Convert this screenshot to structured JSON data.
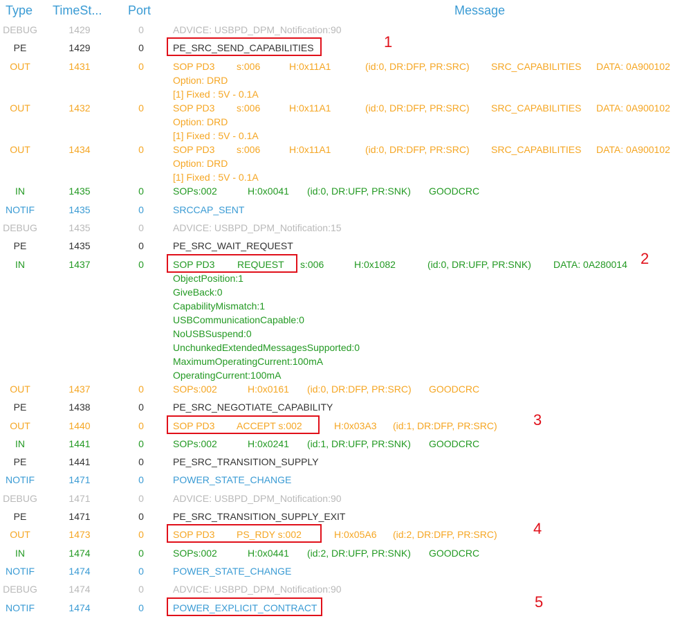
{
  "header": {
    "type": "Type",
    "timestamp": "TimeSt...",
    "port": "Port",
    "message": "Message"
  },
  "colors": {
    "debug": "#b9b9b9",
    "pe": "#333333",
    "out": "#f5a623",
    "in": "#229922",
    "notif": "#3a9bd4",
    "highlight": "#e0101a",
    "header": "#3a9bd4"
  },
  "rows": [
    {
      "type": "DEBUG",
      "ts": "1429",
      "port": "0",
      "segments": [
        "ADVICE: USBPD_DPM_Notification:90"
      ]
    },
    {
      "type": "PE",
      "ts": "1429",
      "port": "0",
      "segments": [
        "PE_SRC_SEND_CAPABILITIES"
      ],
      "callout": "1"
    },
    {
      "type": "OUT",
      "ts": "1431",
      "port": "0",
      "segments": [
        "SOP PD3",
        "s:006",
        "H:0x11A1",
        "(id:0, DR:DFP, PR:SRC)",
        "SRC_CAPABILITIES",
        "DATA: 0A900102"
      ],
      "details": [
        "Option:  DRD",
        " [1] Fixed : 5V - 0.1A"
      ]
    },
    {
      "type": "OUT",
      "ts": "1432",
      "port": "0",
      "segments": [
        "SOP PD3",
        "s:006",
        "H:0x11A1",
        "(id:0, DR:DFP, PR:SRC)",
        "SRC_CAPABILITIES",
        "DATA: 0A900102"
      ],
      "details": [
        "Option:  DRD",
        " [1] Fixed : 5V - 0.1A"
      ]
    },
    {
      "type": "OUT",
      "ts": "1434",
      "port": "0",
      "segments": [
        "SOP PD3",
        "s:006",
        "H:0x11A1",
        "(id:0, DR:DFP, PR:SRC)",
        "SRC_CAPABILITIES",
        "DATA: 0A900102"
      ],
      "details": [
        "Option:  DRD",
        "[1] Fixed : 5V - 0.1A"
      ]
    },
    {
      "type": "IN",
      "ts": "1435",
      "port": "0",
      "segments": [
        "SOPs:002",
        "H:0x0041",
        "(id:0, DR:UFP, PR:SNK)",
        "GOODCRC"
      ]
    },
    {
      "type": "NOTIF",
      "ts": "1435",
      "port": "0",
      "segments": [
        "SRCCAP_SENT"
      ]
    },
    {
      "type": "DEBUG",
      "ts": "1435",
      "port": "0",
      "segments": [
        "ADVICE: USBPD_DPM_Notification:15"
      ]
    },
    {
      "type": "PE",
      "ts": "1435",
      "port": "0",
      "segments": [
        "PE_SRC_WAIT_REQUEST"
      ]
    },
    {
      "type": "IN",
      "ts": "1437",
      "port": "0",
      "segments": [
        "SOP PD3",
        "REQUEST",
        "s:006",
        "H:0x1082",
        "(id:0, DR:UFP, PR:SNK)",
        "DATA: 0A280014"
      ],
      "callout": "2",
      "details": [
        "ObjectPosition:1",
        "GiveBack:0",
        "CapabilityMismatch:1",
        "USBCommunicationCapable:0",
        "NoUSBSuspend:0",
        "UnchunkedExtendedMessagesSupported:0",
        "MaximumOperatingCurrent:100mA",
        "OperatingCurrent:100mA"
      ]
    },
    {
      "type": "OUT",
      "ts": "1437",
      "port": "0",
      "segments": [
        "SOPs:002",
        "H:0x0161",
        "(id:0, DR:DFP, PR:SRC)",
        "GOODCRC"
      ]
    },
    {
      "type": "PE",
      "ts": "1438",
      "port": "0",
      "segments": [
        "PE_SRC_NEGOTIATE_CAPABILITY"
      ]
    },
    {
      "type": "OUT",
      "ts": "1440",
      "port": "0",
      "segments": [
        "SOP PD3",
        "ACCEPT s:002",
        "H:0x03A3",
        "(id:1, DR:DFP, PR:SRC)"
      ],
      "callout": "3"
    },
    {
      "type": "IN",
      "ts": "1441",
      "port": "0",
      "segments": [
        "SOPs:002",
        "H:0x0241",
        "(id:1, DR:UFP, PR:SNK)",
        "GOODCRC"
      ]
    },
    {
      "type": "PE",
      "ts": "1441",
      "port": "0",
      "segments": [
        "PE_SRC_TRANSITION_SUPPLY"
      ]
    },
    {
      "type": "NOTIF",
      "ts": "1471",
      "port": "0",
      "segments": [
        "POWER_STATE_CHANGE"
      ]
    },
    {
      "type": "DEBUG",
      "ts": "1471",
      "port": "0",
      "segments": [
        "ADVICE: USBPD_DPM_Notification:90"
      ]
    },
    {
      "type": "PE",
      "ts": "1471",
      "port": "0",
      "segments": [
        "PE_SRC_TRANSITION_SUPPLY_EXIT"
      ]
    },
    {
      "type": "OUT",
      "ts": "1473",
      "port": "0",
      "segments": [
        "SOP PD3",
        "PS_RDY  s:002",
        "H:0x05A6",
        "(id:2, DR:DFP, PR:SRC)"
      ],
      "callout": "4"
    },
    {
      "type": "IN",
      "ts": "1474",
      "port": "0",
      "segments": [
        "SOPs:002",
        "H:0x0441",
        "(id:2, DR:UFP, PR:SNK)",
        "GOODCRC"
      ]
    },
    {
      "type": "NOTIF",
      "ts": "1474",
      "port": "0",
      "segments": [
        "POWER_STATE_CHANGE"
      ]
    },
    {
      "type": "DEBUG",
      "ts": "1474",
      "port": "0",
      "segments": [
        "ADVICE: USBPD_DPM_Notification:90"
      ]
    },
    {
      "type": "NOTIF",
      "ts": "1474",
      "port": "0",
      "segments": [
        "POWER_EXPLICIT_CONTRACT"
      ],
      "callout": "5"
    }
  ]
}
